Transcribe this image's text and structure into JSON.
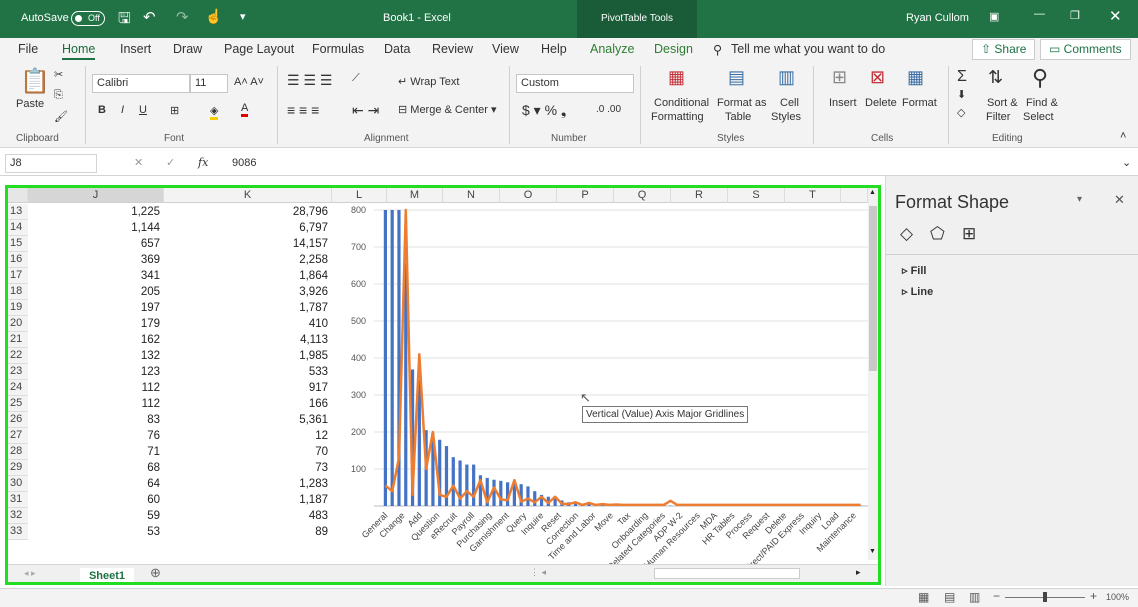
{
  "titlebar": {
    "autosave": "AutoSave",
    "toggle": "Off",
    "doc_title": "Book1 - Excel",
    "context": "PivotTable Tools",
    "user": "Ryan Cullom"
  },
  "tabs": [
    "File",
    "Home",
    "Insert",
    "Draw",
    "Page Layout",
    "Formulas",
    "Data",
    "Review",
    "View",
    "Help",
    "Analyze",
    "Design"
  ],
  "tell_me": "Tell me what you want to do",
  "share": "Share",
  "comments": "Comments",
  "ribbon": {
    "paste": "Paste",
    "clipboard": "Clipboard",
    "font_name": "Calibri",
    "font_size": "11",
    "font": "Font",
    "wrap_text": "Wrap Text",
    "merge_center": "Merge & Center",
    "alignment": "Alignment",
    "number_format": "Custom",
    "number": "Number",
    "conditional": "Conditional",
    "formatting": "Formatting",
    "format_as": "Format as",
    "table": "Table",
    "cell": "Cell",
    "styles_lbl": "Styles",
    "styles": "Styles",
    "insert": "Insert",
    "delete": "Delete",
    "format": "Format",
    "cells": "Cells",
    "sort": "Sort &",
    "filter": "Filter",
    "find": "Find &",
    "select": "Select",
    "editing": "Editing"
  },
  "formula": {
    "namebox": "J8",
    "fx": "fx",
    "value": "9086"
  },
  "columns": {
    "J": "J",
    "K": "K",
    "L": "L",
    "M": "M",
    "N": "N",
    "O": "O",
    "P": "P",
    "Q": "Q",
    "R": "R",
    "S": "S",
    "T": "T"
  },
  "rows": [
    {
      "n": "13",
      "j": "1,225",
      "k": "28,796"
    },
    {
      "n": "14",
      "j": "1,144",
      "k": "6,797"
    },
    {
      "n": "15",
      "j": "657",
      "k": "14,157"
    },
    {
      "n": "16",
      "j": "369",
      "k": "2,258"
    },
    {
      "n": "17",
      "j": "341",
      "k": "1,864"
    },
    {
      "n": "18",
      "j": "205",
      "k": "3,926"
    },
    {
      "n": "19",
      "j": "197",
      "k": "1,787"
    },
    {
      "n": "20",
      "j": "179",
      "k": "410"
    },
    {
      "n": "21",
      "j": "162",
      "k": "4,113"
    },
    {
      "n": "22",
      "j": "132",
      "k": "1,985"
    },
    {
      "n": "23",
      "j": "123",
      "k": "533"
    },
    {
      "n": "24",
      "j": "112",
      "k": "917"
    },
    {
      "n": "25",
      "j": "112",
      "k": "166"
    },
    {
      "n": "26",
      "j": "83",
      "k": "5,361"
    },
    {
      "n": "27",
      "j": "76",
      "k": "12"
    },
    {
      "n": "28",
      "j": "71",
      "k": "70"
    },
    {
      "n": "29",
      "j": "68",
      "k": "73"
    },
    {
      "n": "30",
      "j": "64",
      "k": "1,283"
    },
    {
      "n": "31",
      "j": "60",
      "k": "1,187"
    },
    {
      "n": "32",
      "j": "59",
      "k": "483"
    },
    {
      "n": "33",
      "j": "53",
      "k": "89"
    }
  ],
  "tooltip": "Vertical (Value) Axis Major Gridlines",
  "sheet_tab": "Sheet1",
  "pane": {
    "title": "Format Shape",
    "fill": "Fill",
    "line": "Line"
  },
  "zoom": "100%",
  "chart_data": {
    "type": "bar",
    "ylim": [
      0,
      800
    ],
    "yticks": [
      100,
      200,
      300,
      400,
      500,
      600,
      700,
      800
    ],
    "categories": [
      "General",
      "Change",
      "Add",
      "Question",
      "eRecruit",
      "Payroll",
      "Purchasing",
      "Garnishment",
      "Query",
      "Inquire",
      "Reset",
      "Correction",
      "Time and Labor",
      "Move",
      "Tax",
      "Onboarding",
      "Related Categories",
      "ADP W-2",
      "Human Resources",
      "MDA",
      "HR Tables",
      "Process",
      "Request",
      "Delete",
      "Direct/PAID Express",
      "Inquiry",
      "Load",
      "Maintenance"
    ],
    "series": [
      {
        "values": [
          1225,
          1144,
          800,
          657,
          369,
          341,
          205,
          197,
          179,
          162,
          132,
          123,
          112,
          112,
          83,
          76,
          71,
          68,
          64,
          60,
          59,
          53,
          40,
          30,
          25,
          20,
          15,
          10,
          8,
          6,
          5,
          4,
          3,
          3,
          2,
          2,
          2,
          1,
          1,
          1,
          1,
          1,
          1,
          1,
          1,
          1,
          1,
          1,
          1,
          1,
          1,
          1,
          1,
          1,
          1,
          1,
          1,
          1,
          1,
          1,
          1,
          1,
          1,
          1,
          1,
          1,
          1,
          1,
          1,
          1,
          1
        ]
      },
      {
        "values": [
          55,
          40,
          130,
          800,
          30,
          410,
          100,
          200,
          30,
          25,
          55,
          20,
          40,
          25,
          70,
          10,
          50,
          18,
          15,
          70,
          12,
          20,
          10,
          25,
          8,
          25,
          6,
          5,
          10,
          3,
          8,
          3,
          5,
          3,
          4,
          3,
          3,
          3,
          3,
          3,
          3,
          3,
          14,
          3,
          3,
          3,
          3,
          3,
          3,
          3,
          3,
          3,
          3,
          3,
          3,
          3,
          3,
          3,
          3,
          3,
          3,
          3,
          3,
          3,
          3,
          3,
          3,
          3,
          3,
          3,
          3
        ]
      }
    ]
  }
}
